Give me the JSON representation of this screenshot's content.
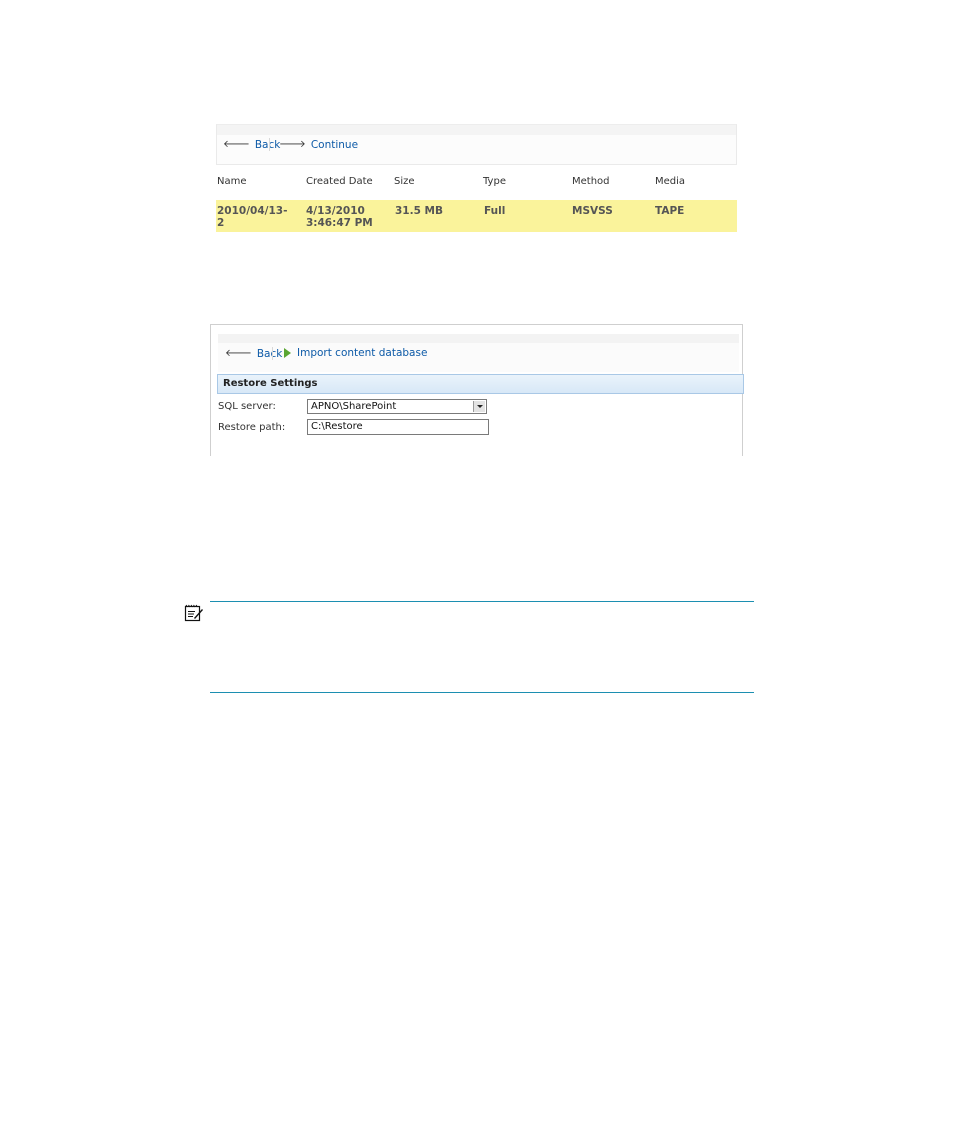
{
  "panel1": {
    "toolbar": {
      "back_label": "Back",
      "continue_label": "Continue"
    },
    "columns": [
      "Name",
      "Created Date",
      "Size",
      "Type",
      "Method",
      "Media"
    ],
    "rows": [
      {
        "name": "2010/04/13-\n2",
        "created": "4/13/2010\n3:46:47 PM",
        "size": "31.5 MB",
        "type": "Full",
        "method": "MSVSS",
        "media": "TAPE"
      }
    ],
    "row_highlight_color": "#faf39b"
  },
  "panel2": {
    "toolbar": {
      "back_label": "Back",
      "import_label": "Import content database"
    },
    "section_title": "Restore Settings",
    "sql_server": {
      "label": "SQL server:",
      "value": "APNO\\SharePoint"
    },
    "restore_path": {
      "label": "Restore path:",
      "value": "C:\\Restore"
    }
  },
  "note": {
    "icon": "note-icon",
    "rule_color": "#1c8fb1"
  }
}
